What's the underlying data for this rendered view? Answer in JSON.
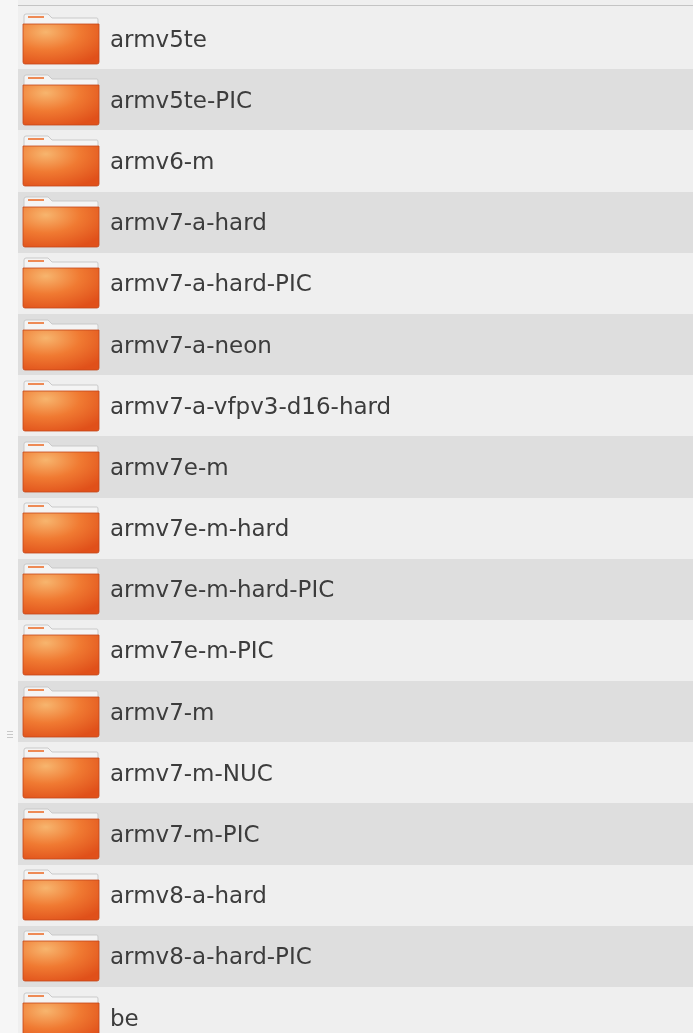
{
  "folders": [
    {
      "name": "armv5te"
    },
    {
      "name": "armv5te-PIC"
    },
    {
      "name": "armv6-m"
    },
    {
      "name": "armv7-a-hard"
    },
    {
      "name": "armv7-a-hard-PIC"
    },
    {
      "name": "armv7-a-neon"
    },
    {
      "name": "armv7-a-vfpv3-d16-hard"
    },
    {
      "name": "armv7e-m"
    },
    {
      "name": "armv7e-m-hard"
    },
    {
      "name": "armv7e-m-hard-PIC"
    },
    {
      "name": "armv7e-m-PIC"
    },
    {
      "name": "armv7-m"
    },
    {
      "name": "armv7-m-NUC"
    },
    {
      "name": "armv7-m-PIC"
    },
    {
      "name": "armv8-a-hard"
    },
    {
      "name": "armv8-a-hard-PIC"
    },
    {
      "name": "be"
    }
  ]
}
